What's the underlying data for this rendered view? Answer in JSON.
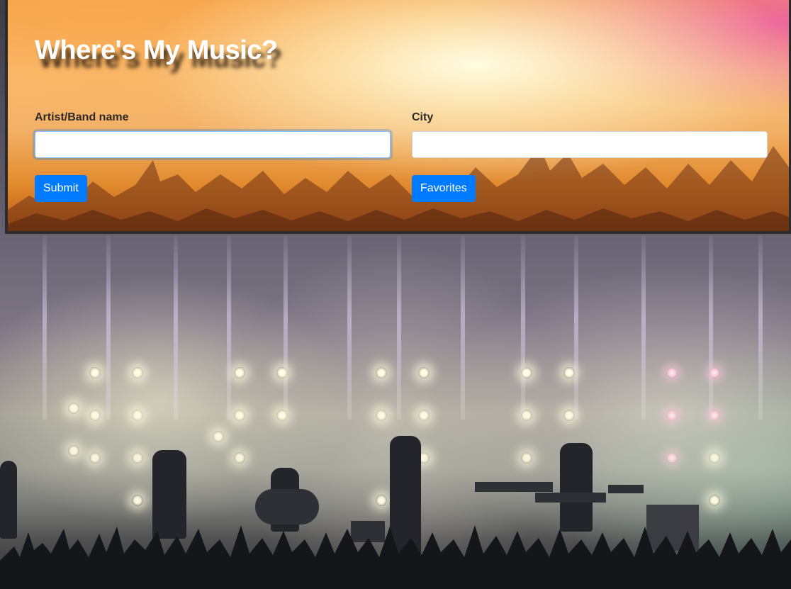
{
  "header": {
    "title": "Where's My Music?"
  },
  "search_form": {
    "artist": {
      "label": "Artist/Band name",
      "value": "",
      "placeholder": ""
    },
    "city": {
      "label": "City",
      "value": "",
      "placeholder": ""
    },
    "submit_label": "Submit",
    "favorites_label": "Favorites"
  },
  "colors": {
    "button_primary": "#007bff",
    "jumbotron_border": "#2b2b2b",
    "label_text": "#2e2a26"
  }
}
